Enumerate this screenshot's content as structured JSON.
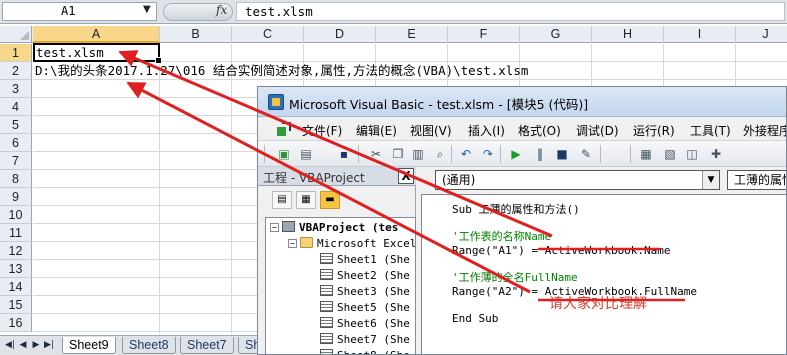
{
  "excel": {
    "name_box": "A1",
    "fx_label": "fx",
    "formula": "test.xlsm",
    "columns": [
      "A",
      "B",
      "C",
      "D",
      "E",
      "F",
      "G",
      "H",
      "I",
      "J"
    ],
    "rows": [
      "1",
      "2",
      "3",
      "4",
      "5",
      "6",
      "7",
      "8",
      "9",
      "10",
      "11",
      "12",
      "13",
      "14",
      "15",
      "16"
    ],
    "cell_a1": "test.xlsm",
    "cell_a2": "D:\\我的头条2017.1.27\\016 结合实例简述对象,属性,方法的概念(VBA)\\test.xlsm",
    "sheet_tabs": [
      "Sheet9",
      "Sheet8",
      "Sheet7",
      "Sh"
    ],
    "sheet_nav": [
      "◀|",
      "◀",
      "▶",
      "▶|"
    ]
  },
  "vba": {
    "title": "Microsoft Visual Basic - test.xlsm - [模块5 (代码)]",
    "menu": [
      "文件(F)",
      "编辑(E)",
      "视图(V)",
      "插入(I)",
      "格式(O)",
      "调试(D)",
      "运行(R)",
      "工具(T)",
      "外接程序"
    ],
    "toolbar_icons": [
      "excel-icon",
      "insert-module-icon",
      "save-icon",
      "cut-icon",
      "copy-icon",
      "paste-icon",
      "find-icon",
      "undo-icon",
      "redo-icon",
      "run-icon",
      "break-icon",
      "reset-icon",
      "design-mode-icon",
      "project-explorer-icon",
      "properties-icon",
      "object-browser-icon",
      "toolbox-icon"
    ],
    "project": {
      "title": "工程 - VBAProject",
      "close": "X",
      "root": "VBAProject (tes",
      "folder": "Microsoft Excel",
      "sheets": [
        "Sheet1 (She",
        "Sheet2 (She",
        "Sheet3 (She",
        "Sheet5 (She",
        "Sheet6 (She",
        "Sheet7 (She",
        "Sheet8 (She"
      ]
    },
    "proc_left": "(通用)",
    "proc_right": "工薄的属性",
    "code": [
      {
        "text": "Sub 工薄的属性和方法()",
        "type": "code"
      },
      {
        "text": "",
        "type": "code"
      },
      {
        "text": "'工作表的名称Name",
        "type": "comment"
      },
      {
        "text": "Range(\"A1\") = ActiveWorkbook.Name",
        "type": "code"
      },
      {
        "text": "",
        "type": "code"
      },
      {
        "text": "'工作薄的全名FullName",
        "type": "comment"
      },
      {
        "text": "Range(\"A2\") = ActiveWorkbook.FullName",
        "type": "code"
      },
      {
        "text": "",
        "type": "code"
      },
      {
        "text": "End Sub",
        "type": "code"
      }
    ],
    "annotation": "请大家对比理解"
  },
  "colors": {
    "arrow": "#e02020",
    "comment": "#008000",
    "annotation": "#d9402b",
    "active_header": "#f9d78a"
  }
}
